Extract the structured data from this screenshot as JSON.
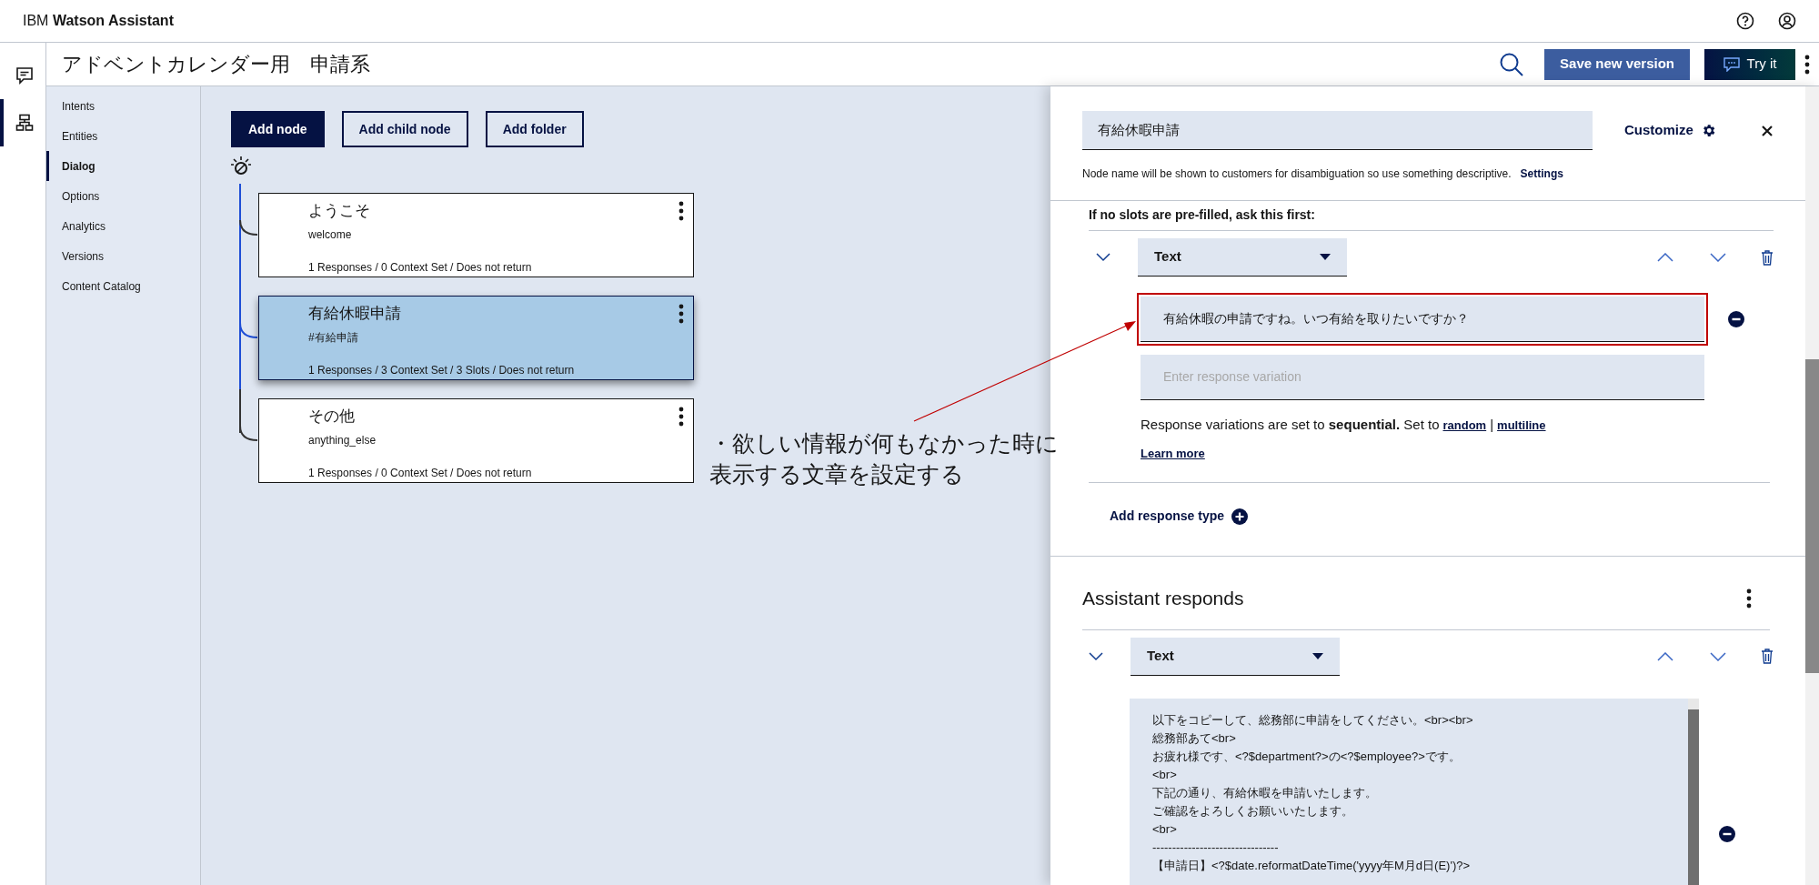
{
  "app_bar": {
    "brand_prefix": "IBM",
    "brand_name": "Watson Assistant"
  },
  "rail": [
    {
      "kind": "chat",
      "selected": false
    },
    {
      "kind": "tree",
      "selected": true
    }
  ],
  "header": {
    "title": "アドベントカレンダー用　申請系",
    "save_button": "Save new version",
    "try_button": "Try it"
  },
  "sidebar": {
    "items": [
      {
        "label": "Intents",
        "selected": false
      },
      {
        "label": "Entities",
        "selected": false
      },
      {
        "label": "Dialog",
        "selected": true
      },
      {
        "label": "Options",
        "selected": false
      },
      {
        "label": "Analytics",
        "selected": false
      },
      {
        "label": "Versions",
        "selected": false
      },
      {
        "label": "Content Catalog",
        "selected": false
      }
    ]
  },
  "toolbar": [
    {
      "label": "Add node",
      "kind": "primary"
    },
    {
      "label": "Add child node",
      "kind": "outline"
    },
    {
      "label": "Add folder",
      "kind": "outline"
    }
  ],
  "nodes": [
    {
      "title": "ようこそ",
      "condition": "welcome",
      "summary": "1 Responses / 0 Context Set / Does not return",
      "selected": false
    },
    {
      "title": "有給休暇申請",
      "condition": "#有給申請",
      "summary": "1 Responses / 3 Context Set / 3 Slots / Does not return",
      "selected": true
    },
    {
      "title": "その他",
      "condition": "anything_else",
      "summary": "1 Responses / 0 Context Set / Does not return",
      "selected": false
    }
  ],
  "annotation": {
    "lines": [
      "・欲しい情報が何もなかった時に",
      "表示する文章を設定する"
    ]
  },
  "panel": {
    "node_name": "有給休暇申請",
    "customize": "Customize",
    "helper": "Node name will be shown to customers for disambiguation so use something descriptive.",
    "settings_link": "Settings",
    "slot_prompt": {
      "label": "If no slots are pre-filled, ask this first:",
      "response_type": "Text",
      "variations": [
        {
          "value": "有給休暇の申請ですね。いつ有給を取りたいですか？",
          "highlighted": true
        },
        {
          "placeholder": "Enter response variation",
          "highlighted": false
        }
      ],
      "mode_sentence": "Response variations are set to **sequential.** Set to",
      "links": [
        "random",
        "multiline"
      ],
      "separator": "|",
      "learn_more": "Learn more"
    },
    "add_response_type": "Add response type",
    "assistant_responds": {
      "title": "Assistant responds",
      "response_type": "Text",
      "lines": [
        "以下をコピーして、総務部に申請をしてください。<br><br>",
        "総務部あて<br>",
        "お疲れ様です、<?$department?>の<?$employee?>です。",
        "<br>",
        "下記の通り、有給休暇を申請いたします。",
        "ご確認をよろしくお願いいたします。",
        "<br>",
        "--------------------------------",
        "【申請日】<?$date.reformatDateTime('yyyy年M月d日(E)')?>"
      ]
    }
  }
}
